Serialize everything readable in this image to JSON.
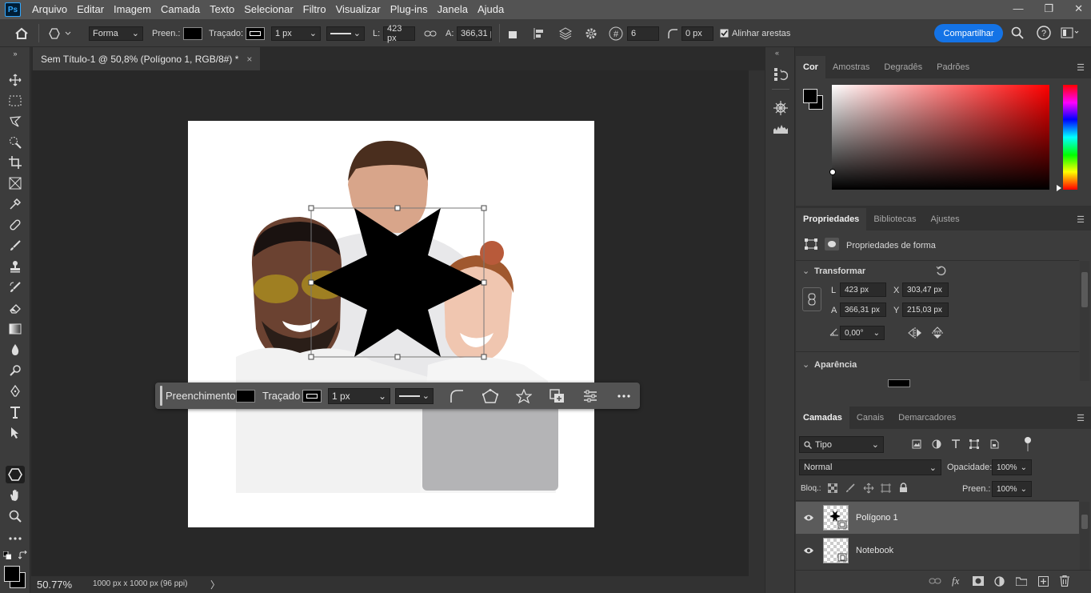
{
  "app": {
    "logo_text": "Ps"
  },
  "menu": [
    "Arquivo",
    "Editar",
    "Imagem",
    "Camada",
    "Texto",
    "Selecionar",
    "Filtro",
    "Visualizar",
    "Plug-ins",
    "Janela",
    "Ajuda"
  ],
  "window_controls": {
    "minimize": "—",
    "restore": "❐",
    "close": "✕"
  },
  "options": {
    "mode": "Forma",
    "fill_label": "Preen.:",
    "stroke_label": "Traçado:",
    "stroke_width": "1 px",
    "width_label": "L:",
    "width": "423 px",
    "height_label": "A:",
    "height": "366,31 p",
    "sides": "6",
    "radius": "0 px",
    "align_edges": "Alinhar arestas",
    "share": "Compartilhar"
  },
  "document": {
    "tab_title": "Sem Título-1 @ 50,8% (Polígono 1, RGB/8#) *",
    "close": "×",
    "zoom": "50.77%",
    "doc_info": "1000 px x 1000 px (96 ppi)"
  },
  "context_bar": {
    "fill_label": "Preenchimento",
    "stroke_label": "Traçado",
    "stroke_width": "1 px"
  },
  "color_panel": {
    "tabs": [
      "Cor",
      "Amostras",
      "Degradês",
      "Padrões"
    ],
    "hue": "#ff0000"
  },
  "properties_panel": {
    "tabs": [
      "Propriedades",
      "Bibliotecas",
      "Ajustes"
    ],
    "shape_props_label": "Propriedades de forma",
    "transform_title": "Transformar",
    "w_label": "L",
    "w": "423 px",
    "x_label": "X",
    "x": "303,47 px",
    "h_label": "A",
    "h": "366,31 px",
    "y_label": "Y",
    "y": "215,03 px",
    "angle": "0,00°",
    "appearance_title": "Aparência"
  },
  "layers_panel": {
    "tabs": [
      "Camadas",
      "Canais",
      "Demarcadores"
    ],
    "filter": "Tipo",
    "blend_mode": "Normal",
    "opacity_label": "Opacidade:",
    "opacity": "100%",
    "lock_label": "Bloq.:",
    "fill_label": "Preen.:",
    "fill": "100%",
    "layers": [
      {
        "name": "Polígono 1",
        "selected": true
      },
      {
        "name": "Notebook",
        "selected": false
      }
    ]
  }
}
